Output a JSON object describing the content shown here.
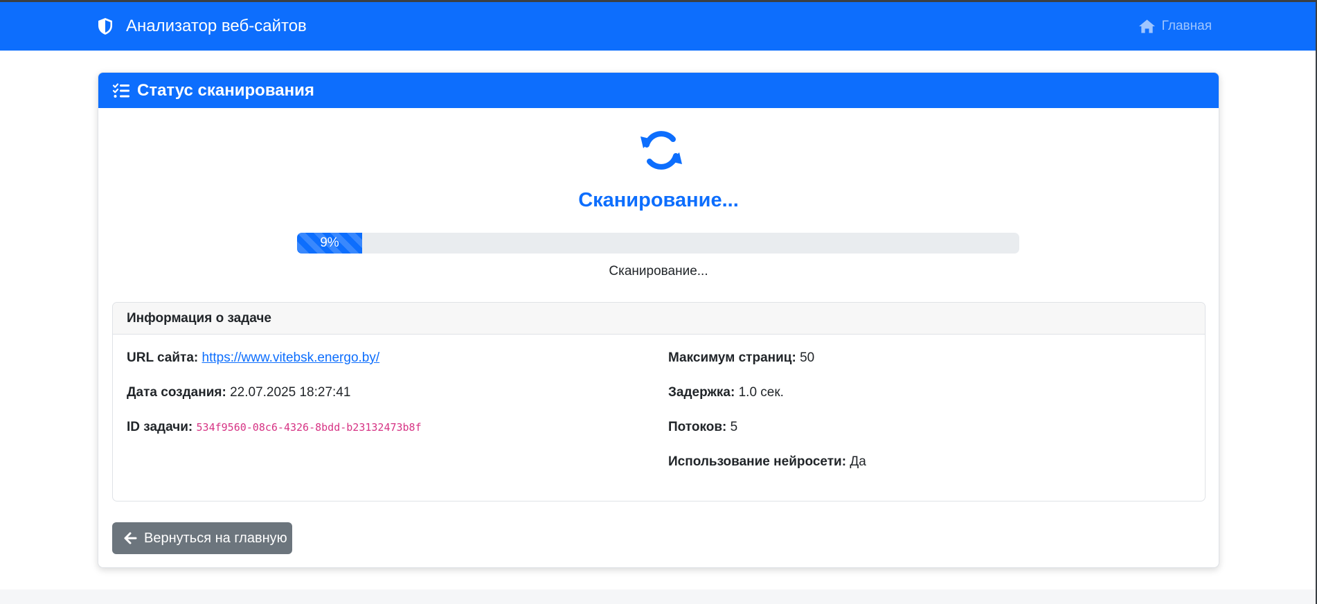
{
  "navbar": {
    "brand_label": "Анализатор веб-сайтов",
    "home_label": "Главная"
  },
  "card": {
    "header_title": "Статус сканирования",
    "status_title": "Сканирование...",
    "progress_label": "9%",
    "progress_value": 0.09,
    "status_text": "Сканирование..."
  },
  "task_info": {
    "title": "Информация о задаче",
    "url_label": "URL сайта:",
    "url_value": "https://www.vitebsk.energo.by/",
    "created_label": "Дата создания:",
    "created_value": "22.07.2025 18:27:41",
    "id_label": "ID задачи:",
    "id_value": "534f9560-08c6-4326-8bdd-b23132473b8f",
    "max_pages_label": "Максимум страниц:",
    "max_pages_value": "50",
    "delay_label": "Задержка:",
    "delay_value": "1.0 сек.",
    "threads_label": "Потоков:",
    "threads_value": "5",
    "ai_label": "Использование нейросети:",
    "ai_value": "Да"
  },
  "back_button_label": "Вернуться на главную",
  "colors": {
    "primary": "#0d6efd",
    "secondary": "#6c757d",
    "code": "#d63384"
  },
  "icons": {
    "brand": "shield-icon",
    "home": "home-icon",
    "header": "list-check-icon",
    "spinner": "sync-icon",
    "back": "arrow-left-icon"
  }
}
